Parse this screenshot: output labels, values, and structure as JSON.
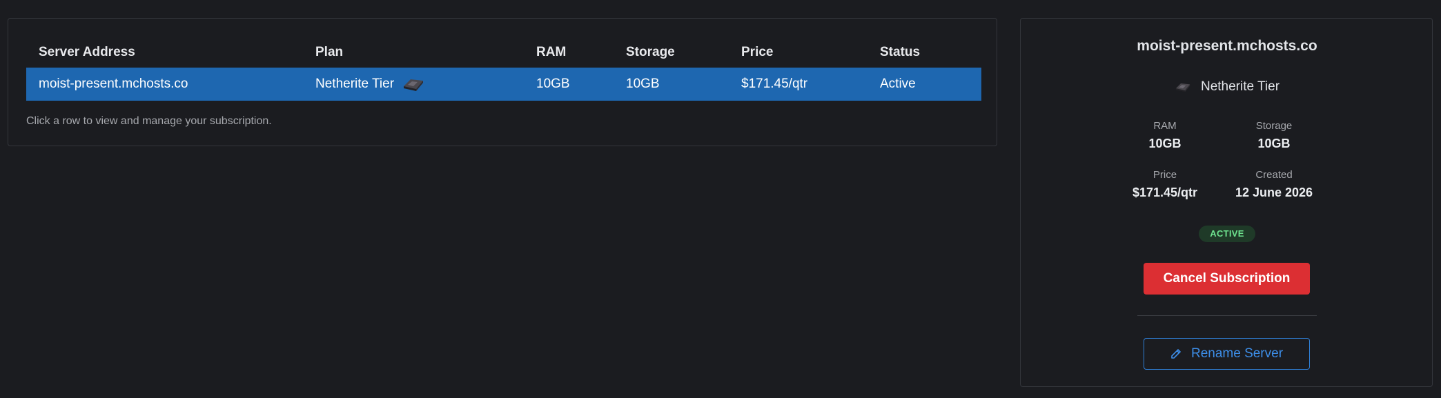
{
  "table": {
    "headers": {
      "server_address": "Server Address",
      "plan": "Plan",
      "ram": "RAM",
      "storage": "Storage",
      "price": "Price",
      "status": "Status"
    },
    "rows": [
      {
        "server_address": "moist-present.mchosts.co",
        "plan": "Netherite Tier",
        "plan_icon": "netherite-ingot-icon",
        "ram": "10GB",
        "storage": "10GB",
        "price": "$171.45/qtr",
        "status": "Active"
      }
    ],
    "hint": "Click a row to view and manage your subscription."
  },
  "detail": {
    "title": "moist-present.mchosts.co",
    "plan": "Netherite Tier",
    "plan_icon": "netherite-ingot-icon",
    "ram_label": "RAM",
    "ram_value": "10GB",
    "storage_label": "Storage",
    "storage_value": "10GB",
    "price_label": "Price",
    "price_value": "$171.45/qtr",
    "created_label": "Created",
    "created_value": "12 June 2026",
    "status_badge": "ACTIVE",
    "cancel_label": "Cancel Subscription",
    "rename_label": "Rename Server",
    "rename_icon": "pencil-icon"
  },
  "colors": {
    "background": "#1b1c20",
    "selected_row": "#1e67b0",
    "cancel_button": "#dc2f33",
    "rename_accent": "#3d8ee8",
    "active_badge_text": "#6ee38f",
    "active_badge_bg": "#1f3a28"
  }
}
